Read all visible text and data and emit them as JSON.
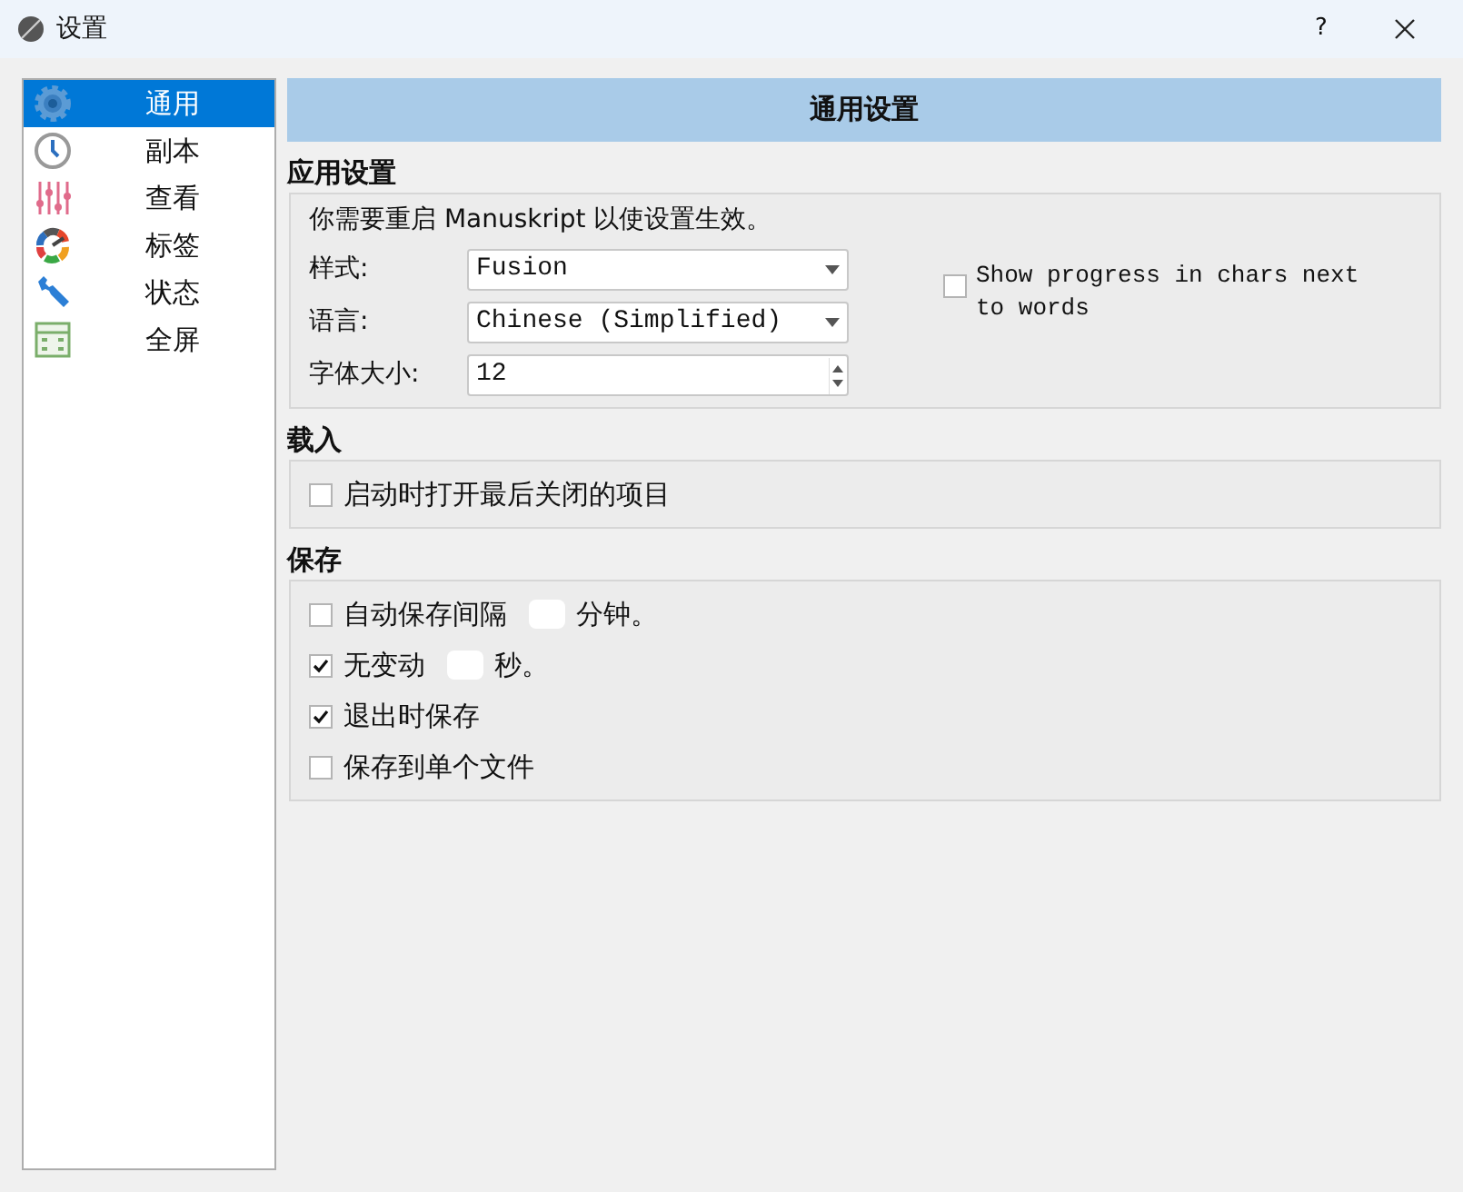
{
  "window": {
    "title": "设置",
    "help": "?"
  },
  "sidebar": {
    "items": [
      {
        "label": "通用",
        "selected": true
      },
      {
        "label": "副本",
        "selected": false
      },
      {
        "label": "查看",
        "selected": false
      },
      {
        "label": "标签",
        "selected": false
      },
      {
        "label": "状态",
        "selected": false
      },
      {
        "label": "全屏",
        "selected": false
      }
    ]
  },
  "header": "通用设置",
  "app_settings": {
    "title": "应用设置",
    "notice": "你需要重启 Manuskript 以使设置生效。",
    "style": {
      "label": "样式:",
      "value": "Fusion"
    },
    "language": {
      "label": "语言:",
      "value": "Chinese (Simplified)"
    },
    "font_size": {
      "label": "字体大小:",
      "value": "12"
    },
    "show_progress": {
      "label": "Show progress in chars next to words",
      "checked": false
    }
  },
  "loading": {
    "title": "载入",
    "items": [
      {
        "kind": "checkbox",
        "label": "启动时打开最后关闭的项目",
        "checked": false
      }
    ]
  },
  "saving": {
    "title": "保存",
    "items": [
      {
        "kind": "interval",
        "label": "自动保存间隔",
        "suffix": "分钟。",
        "checked": false
      },
      {
        "kind": "interval",
        "label": "无变动",
        "suffix": "秒。",
        "checked": true
      },
      {
        "kind": "checkbox",
        "label": "退出时保存",
        "checked": true
      },
      {
        "kind": "checkbox",
        "label": "保存到单个文件",
        "checked": false
      }
    ]
  }
}
